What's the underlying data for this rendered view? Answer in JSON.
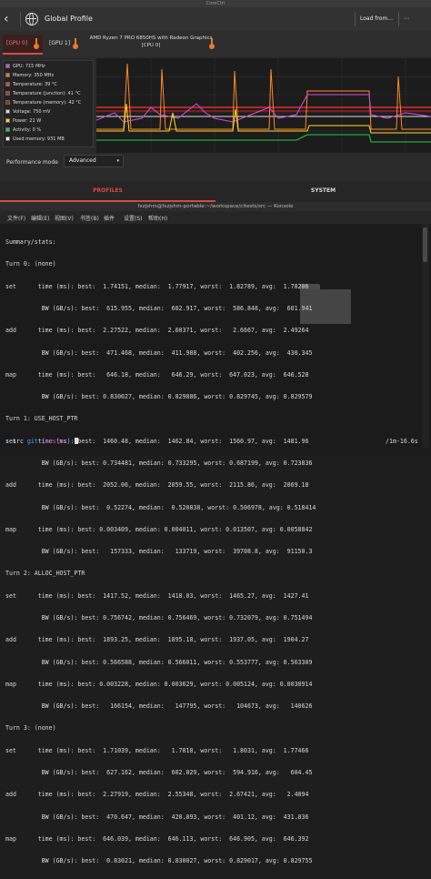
{
  "corectrl": {
    "window_title": "CoreCtrl",
    "back_symbol": "‹",
    "profile_title": "Global Profile",
    "load_label": "Load from...",
    "save_symbol": "⋯",
    "tabs": [
      {
        "label": "[GPU 0]"
      },
      {
        "label": "[GPU 1]"
      },
      {
        "label": "AMD Ryzen 7 PRO 6850HS with Radeon Graphics",
        "sub": "[CPU 0]"
      }
    ],
    "sensors": [
      {
        "label": "GPU: 715 MHz",
        "color": "#d44fd4",
        "checked": true
      },
      {
        "label": "Memory: 350 MHz",
        "color": "#ff7a2a",
        "checked": true
      },
      {
        "label": "Temperature: 39 °C",
        "color": "#ff3a3a",
        "checked": true
      },
      {
        "label": "Temperature (junction): 41 °C",
        "color": "#cc2e2e",
        "checked": true
      },
      {
        "label": "Temperature (memory): 42 °C",
        "color": "#b02020",
        "checked": true
      },
      {
        "label": "Voltage: 750 mV",
        "color": "#dddddd",
        "checked": true
      },
      {
        "label": "Power: 21 W",
        "color": "#ffdd22",
        "checked": true
      },
      {
        "label": "Activity: 0 %",
        "color": "#22cc44",
        "checked": true
      },
      {
        "label": "Used memory: 931 MB",
        "color": "#ffffff",
        "checked": true
      }
    ],
    "perf_mode_label": "Performance mode",
    "perf_mode_value": "Advanced",
    "perf_mode_arrow": "▾",
    "bottom_tabs": [
      "PROFILES",
      "SYSTEM"
    ],
    "accent": "#d84848"
  },
  "konsole": {
    "window_title": "fxzjshm@fxzjshm-portable:~/workspace/citests/src — Konsole",
    "menu": [
      "文件(F)",
      "编辑(E)",
      "视图(V)",
      "书签(B)",
      "插件",
      "设置(S)",
      "帮助(H)"
    ],
    "lines": [
      "Summary/stats:",
      "Turn 0: (none)",
      "set      time (ms): best:  1.74151, median:  1.77917, worst:  1.82789, avg:  1.78206",
      "          BW (GB/s): best:  615.955, median:  602.917, worst:  586.848, avg:  601.941",
      "add      time (ms): best:  2.27522, median:  2.60371, worst:   2.6667, avg:  2.49264",
      "          BW (GB/s): best:  471.468, median:  411.988, worst:  402.256, avg:  430.345",
      "map      time (ms): best:   646.18, median:   646.29, worst:  647.023, avg:  646.528",
      "          BW (GB/s): best: 0.830027, median: 0.829886, worst: 0.829745, avg: 0.829579",
      "Turn 1: USE_HOST_PTR",
      "set      time (ms): best:  1460.48, median:  1462.84, worst:  1560.97, avg:  1481.96",
      "          BW (GB/s): best: 0.734481, median: 0.733295, worst: 0.687199, avg: 0.723836",
      "add      time (ms): best:  2052.06, median:  2059.55, worst:  2115.86, avg:  2069.18",
      "          BW (GB/s): best:  0.52274, median:  0.520838, worst: 0.506978, avg: 0.518414",
      "map      time (ms): best: 0.003409, median: 0.004011, worst: 0.013507, avg: 0.0058842",
      "          BW (GB/s): best:   157333, median:   133719, worst:  39708.8, avg:  91150.3",
      "Turn 2: ALLOC_HOST_PTR",
      "set      time (ms): best:  1417.52, median:  1418.03, worst:  1465.27, avg:  1427.41",
      "          BW (GB/s): best: 0.756742, median: 0.756469, worst: 0.732079, avg: 0.751494",
      "add      time (ms): best:  1893.25, median:  1895.18, worst:  1937.05, avg:  1904.27",
      "          BW (GB/s): best: 0.566588, median: 0.566011, worst: 0.553777, avg: 0.563309",
      "map      time (ms): best: 0.003228, median: 0.003629, worst: 0.005124, avg: 0.0038914",
      "          BW (GB/s): best:   166154, median:   147795, worst:   104673, avg:   140626",
      "Turn 3: (none)",
      "set      time (ms): best:  1.71039, median:   1.7818, worst:   1.8031, avg:  1.77466",
      "          BW (GB/s): best:  627.162, median:  602.029, worst:  594.916, avg:   604.45",
      "add      time (ms): best:  2.27919, median:  2.55348, worst:  2.67421, avg:   2.4894",
      "          BW (GB/s): best:  470.647, median:  420.093, worst:  401.12, avg:  431.036",
      "map      time (ms): best:  646.039, median:  646.113, worst:  646.905, avg:  646.392",
      "          BW (GB/s): best:  0.83021, median: 0.830027, worst: 0.829017, avg: 0.829755"
    ],
    "prompt_arrow": "↑",
    "prompt_path": "src",
    "prompt_git": "git:(",
    "prompt_branch": "master",
    "prompt_close": ")",
    "run_time": "/1m-16.6s"
  }
}
